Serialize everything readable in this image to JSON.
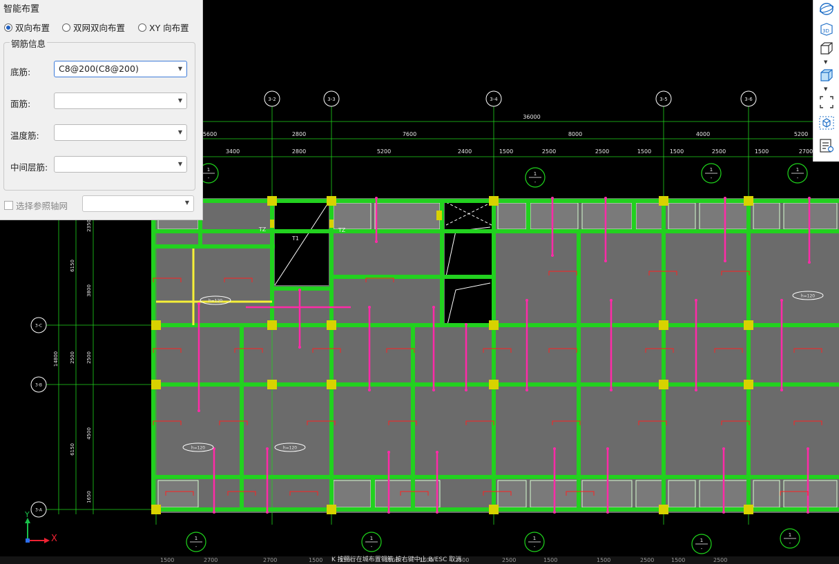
{
  "panel": {
    "title": "智能布置",
    "radios": [
      {
        "label": "双向布置",
        "checked": true
      },
      {
        "label": "双网双向布置",
        "checked": false
      },
      {
        "label": "XY 向布置",
        "checked": false
      }
    ],
    "group_title": "钢筋信息",
    "fields": [
      {
        "label": "底筋:",
        "value": "C8@200(C8@200)"
      },
      {
        "label": "面筋:",
        "value": ""
      },
      {
        "label": "温度筋:",
        "value": ""
      },
      {
        "label": "中间层筋:",
        "value": ""
      }
    ],
    "ref_grid_label": "选择参照轴网",
    "ref_grid_value": ""
  },
  "toolbar": {
    "icons": [
      "orbit-icon",
      "3d-view-icon",
      "cube-wire-icon",
      "cube-shaded-icon",
      "zoom-extents-icon",
      "isometric-icon",
      "properties-icon"
    ]
  },
  "drawing": {
    "axis_bubbles_top": [
      "3-2",
      "3-3",
      "3-4",
      "3-5",
      "3-6"
    ],
    "axis_bubbles_left": [
      "3-C",
      "3-B",
      "3-A"
    ],
    "overall_dim": "36000",
    "dims_row1": [
      "5600",
      "2800",
      "7600",
      "8000",
      "4000",
      "5200"
    ],
    "dims_row2": [
      "3400",
      "2800",
      "5200",
      "2400",
      "1500",
      "2500",
      "2500",
      "1500",
      "1500",
      "2500",
      "1500",
      "2700"
    ],
    "dims_bottom": [
      "1500",
      "2700",
      "2700",
      "1500",
      "1500",
      "2500",
      "1500",
      "2500",
      "2500",
      "1500",
      "1500",
      "2500",
      "1500",
      "2500"
    ],
    "dims_left": [
      "2350",
      "6150",
      "3800",
      "2500",
      "14800",
      "2500",
      "4500",
      "6150",
      "1650"
    ],
    "section_marks": [
      "1",
      "1",
      "1",
      "1",
      "1",
      "1",
      "1",
      "1",
      "1"
    ],
    "section_sub": "-",
    "slab_labels": [
      "h=120",
      "h=120",
      "h=120",
      "h=120"
    ],
    "column_tags": [
      "TZ",
      "TZ"
    ],
    "stair_tag": "T1",
    "axis_x_label": "X",
    "axis_y_label": "Y"
  },
  "status": {
    "message": "K 按照行在城布置钢筋,按右键中止 B/ESC 取消"
  },
  "colors": {
    "beam": "#22d11f",
    "slab": "#6b6b6b",
    "column": "#d8d200",
    "grid": "#1fd51c",
    "rebar": "#ff2aa8",
    "dim_text": "#e8e8e8",
    "red_mark": "#ff2020"
  }
}
